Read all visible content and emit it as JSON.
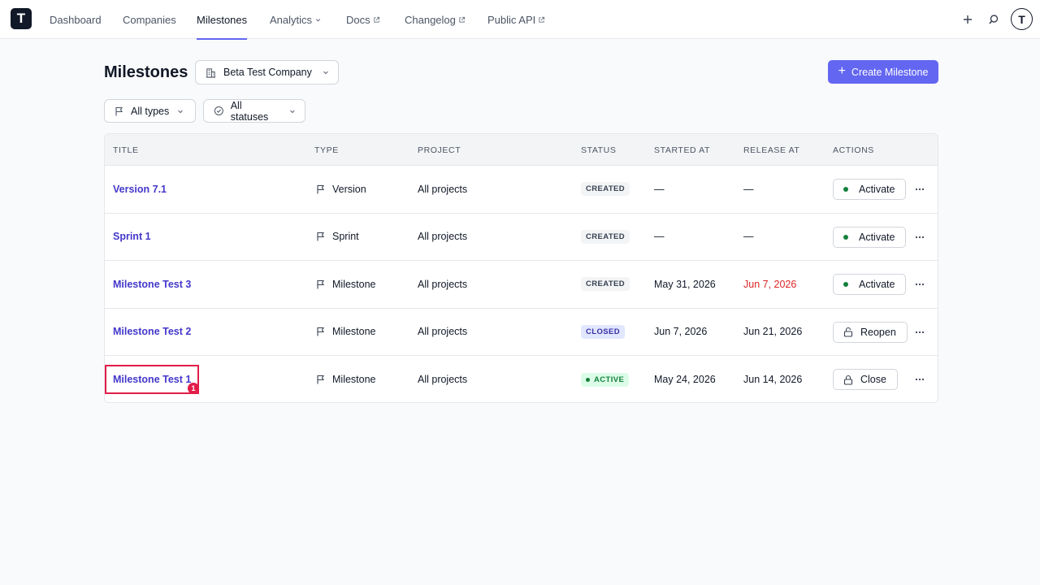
{
  "nav": {
    "logo_letter": "T",
    "items": [
      {
        "label": "Dashboard"
      },
      {
        "label": "Companies"
      },
      {
        "label": "Milestones"
      },
      {
        "label": "Analytics"
      },
      {
        "label": "Docs"
      },
      {
        "label": "Changelog"
      },
      {
        "label": "Public API"
      }
    ],
    "active": "Milestones",
    "right_icons": [
      "plus-icon",
      "search-icon",
      "avatar"
    ]
  },
  "header": {
    "title": "Milestones",
    "company_select": "Beta Test Company",
    "create_button": "Create Milestone"
  },
  "filters": {
    "types": "All types",
    "statuses": "All statuses"
  },
  "table": {
    "columns": [
      "TITLE",
      "TYPE",
      "PROJECT",
      "STATUS",
      "STARTED AT",
      "RELEASE AT",
      "ACTIONS"
    ],
    "rows": [
      {
        "title": "Version 7.1",
        "type": "Version",
        "project": "All projects",
        "status": "CREATED",
        "started": "—",
        "release": "—",
        "action": "Activate"
      },
      {
        "title": "Sprint 1",
        "type": "Sprint",
        "project": "All projects",
        "status": "CREATED",
        "started": "—",
        "release": "—",
        "action": "Activate"
      },
      {
        "title": "Milestone Test 3",
        "type": "Milestone",
        "project": "All projects",
        "status": "CREATED",
        "started": "May 31, 2026",
        "release": "Jun 7, 2026",
        "action": "Activate"
      },
      {
        "title": "Milestone Test 2",
        "type": "Milestone",
        "project": "All projects",
        "status": "CLOSED",
        "started": "Jun 7, 2026",
        "release": "Jun 21, 2026",
        "action": "Reopen"
      },
      {
        "title": "Milestone Test 1",
        "type": "Milestone",
        "project": "All projects",
        "status": "ACTIVE",
        "started": "May 24, 2026",
        "release": "Jun 14, 2026",
        "action": "Close"
      }
    ]
  },
  "annotation": {
    "marker": "1"
  },
  "colors": {
    "accent": "#6366f1",
    "link": "#4338ca",
    "overdue": "#dc2626",
    "active_green": "#15803d",
    "marker_red": "#e11d48"
  }
}
